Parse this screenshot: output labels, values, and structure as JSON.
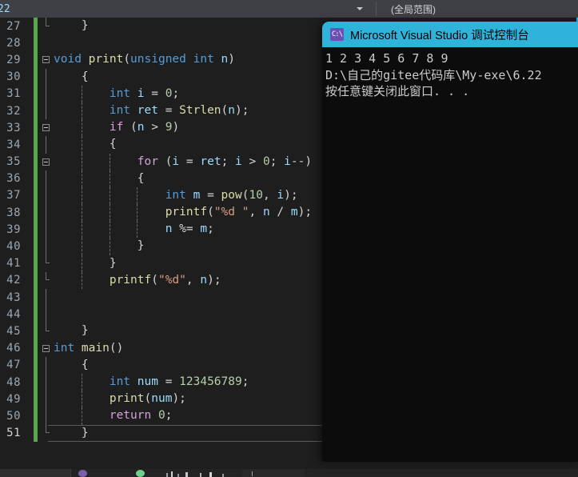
{
  "nav": {
    "member_combo_value": "22",
    "scope_combo_value": "(全局范围)",
    "dropdown_icon": "chevron-down-icon"
  },
  "editor": {
    "language": "C",
    "current_line": 51,
    "lines": [
      {
        "num": "27",
        "indent_guides": [],
        "fold": "endcap",
        "tokens": [
          {
            "t": "    }",
            "c": "pun"
          }
        ]
      },
      {
        "num": "28",
        "indent_guides": [],
        "fold": "",
        "tokens": [
          {
            "t": "",
            "c": "pun"
          }
        ]
      },
      {
        "num": "29",
        "indent_guides": [],
        "fold": "box",
        "tokens": [
          {
            "t": "void ",
            "c": "kw"
          },
          {
            "t": "print",
            "c": "fn"
          },
          {
            "t": "(",
            "c": "pun"
          },
          {
            "t": "unsigned int ",
            "c": "kw"
          },
          {
            "t": "n",
            "c": "var"
          },
          {
            "t": ")",
            "c": "pun"
          }
        ]
      },
      {
        "num": "30",
        "indent_guides": [],
        "fold": "line",
        "tokens": [
          {
            "t": "    {",
            "c": "pun"
          }
        ]
      },
      {
        "num": "31",
        "indent_guides": [
          1
        ],
        "fold": "line",
        "tokens": [
          {
            "t": "        ",
            "c": "pun"
          },
          {
            "t": "int ",
            "c": "kw"
          },
          {
            "t": "i ",
            "c": "var"
          },
          {
            "t": "= ",
            "c": "pun"
          },
          {
            "t": "0",
            "c": "num"
          },
          {
            "t": ";",
            "c": "pun"
          }
        ]
      },
      {
        "num": "32",
        "indent_guides": [
          1
        ],
        "fold": "line",
        "tokens": [
          {
            "t": "        ",
            "c": "pun"
          },
          {
            "t": "int ",
            "c": "kw"
          },
          {
            "t": "ret ",
            "c": "var"
          },
          {
            "t": "= ",
            "c": "pun"
          },
          {
            "t": "Strlen",
            "c": "fn"
          },
          {
            "t": "(",
            "c": "pun"
          },
          {
            "t": "n",
            "c": "var"
          },
          {
            "t": ");",
            "c": "pun"
          }
        ]
      },
      {
        "num": "33",
        "indent_guides": [
          1
        ],
        "fold": "box",
        "tokens": [
          {
            "t": "        ",
            "c": "pun"
          },
          {
            "t": "if ",
            "c": "ctl"
          },
          {
            "t": "(",
            "c": "pun"
          },
          {
            "t": "n ",
            "c": "var"
          },
          {
            "t": "> ",
            "c": "pun"
          },
          {
            "t": "9",
            "c": "num"
          },
          {
            "t": ")",
            "c": "pun"
          }
        ]
      },
      {
        "num": "34",
        "indent_guides": [
          1
        ],
        "fold": "line",
        "tokens": [
          {
            "t": "        {",
            "c": "pun"
          }
        ]
      },
      {
        "num": "35",
        "indent_guides": [
          1,
          2
        ],
        "fold": "box",
        "tokens": [
          {
            "t": "            ",
            "c": "pun"
          },
          {
            "t": "for ",
            "c": "ctl"
          },
          {
            "t": "(",
            "c": "pun"
          },
          {
            "t": "i ",
            "c": "var"
          },
          {
            "t": "= ",
            "c": "pun"
          },
          {
            "t": "ret",
            "c": "var"
          },
          {
            "t": "; ",
            "c": "pun"
          },
          {
            "t": "i ",
            "c": "var"
          },
          {
            "t": "> ",
            "c": "pun"
          },
          {
            "t": "0",
            "c": "num"
          },
          {
            "t": "; ",
            "c": "pun"
          },
          {
            "t": "i",
            "c": "var"
          },
          {
            "t": "--)",
            "c": "pun"
          }
        ]
      },
      {
        "num": "36",
        "indent_guides": [
          1,
          2
        ],
        "fold": "line",
        "tokens": [
          {
            "t": "            {",
            "c": "pun"
          }
        ]
      },
      {
        "num": "37",
        "indent_guides": [
          1,
          2,
          3
        ],
        "fold": "line",
        "tokens": [
          {
            "t": "                ",
            "c": "pun"
          },
          {
            "t": "int ",
            "c": "kw"
          },
          {
            "t": "m ",
            "c": "var"
          },
          {
            "t": "= ",
            "c": "pun"
          },
          {
            "t": "pow",
            "c": "fn"
          },
          {
            "t": "(",
            "c": "pun"
          },
          {
            "t": "10",
            "c": "num"
          },
          {
            "t": ", ",
            "c": "pun"
          },
          {
            "t": "i",
            "c": "var"
          },
          {
            "t": ");",
            "c": "pun"
          }
        ]
      },
      {
        "num": "38",
        "indent_guides": [
          1,
          2,
          3
        ],
        "fold": "line",
        "tokens": [
          {
            "t": "                ",
            "c": "pun"
          },
          {
            "t": "printf",
            "c": "fn"
          },
          {
            "t": "(",
            "c": "pun"
          },
          {
            "t": "\"%d \"",
            "c": "str"
          },
          {
            "t": ", ",
            "c": "pun"
          },
          {
            "t": "n ",
            "c": "var"
          },
          {
            "t": "/ ",
            "c": "pun"
          },
          {
            "t": "m",
            "c": "var"
          },
          {
            "t": ");",
            "c": "pun"
          }
        ]
      },
      {
        "num": "39",
        "indent_guides": [
          1,
          2,
          3
        ],
        "fold": "line",
        "tokens": [
          {
            "t": "                ",
            "c": "pun"
          },
          {
            "t": "n ",
            "c": "var"
          },
          {
            "t": "%= ",
            "c": "pun"
          },
          {
            "t": "m",
            "c": "var"
          },
          {
            "t": ";",
            "c": "pun"
          }
        ]
      },
      {
        "num": "40",
        "indent_guides": [
          1,
          2
        ],
        "fold": "line",
        "tokens": [
          {
            "t": "            }",
            "c": "pun"
          }
        ]
      },
      {
        "num": "41",
        "indent_guides": [
          1
        ],
        "fold": "endcap",
        "tokens": [
          {
            "t": "        }",
            "c": "pun"
          }
        ]
      },
      {
        "num": "42",
        "indent_guides": [
          1
        ],
        "fold": "endcap",
        "tokens": [
          {
            "t": "        ",
            "c": "pun"
          },
          {
            "t": "printf",
            "c": "fn"
          },
          {
            "t": "(",
            "c": "pun"
          },
          {
            "t": "\"%d\"",
            "c": "str"
          },
          {
            "t": ", ",
            "c": "pun"
          },
          {
            "t": "n",
            "c": "var"
          },
          {
            "t": ");",
            "c": "pun"
          }
        ]
      },
      {
        "num": "43",
        "indent_guides": [
          1
        ],
        "fold": "line",
        "tokens": [
          {
            "t": "",
            "c": "pun"
          }
        ]
      },
      {
        "num": "44",
        "indent_guides": [
          1
        ],
        "fold": "line",
        "tokens": [
          {
            "t": "",
            "c": "pun"
          }
        ]
      },
      {
        "num": "45",
        "indent_guides": [],
        "fold": "endcap",
        "tokens": [
          {
            "t": "    }",
            "c": "pun"
          }
        ]
      },
      {
        "num": "46",
        "indent_guides": [],
        "fold": "box",
        "tokens": [
          {
            "t": "int ",
            "c": "kw"
          },
          {
            "t": "main",
            "c": "fn"
          },
          {
            "t": "()",
            "c": "pun"
          }
        ]
      },
      {
        "num": "47",
        "indent_guides": [],
        "fold": "line",
        "tokens": [
          {
            "t": "    {",
            "c": "pun"
          }
        ]
      },
      {
        "num": "48",
        "indent_guides": [
          1
        ],
        "fold": "line",
        "tokens": [
          {
            "t": "        ",
            "c": "pun"
          },
          {
            "t": "int ",
            "c": "kw"
          },
          {
            "t": "num ",
            "c": "var"
          },
          {
            "t": "= ",
            "c": "pun"
          },
          {
            "t": "123456789",
            "c": "num"
          },
          {
            "t": ";",
            "c": "pun"
          }
        ]
      },
      {
        "num": "49",
        "indent_guides": [
          1
        ],
        "fold": "line",
        "tokens": [
          {
            "t": "        ",
            "c": "pun"
          },
          {
            "t": "print",
            "c": "fn"
          },
          {
            "t": "(",
            "c": "pun"
          },
          {
            "t": "num",
            "c": "var"
          },
          {
            "t": ");",
            "c": "pun"
          }
        ]
      },
      {
        "num": "50",
        "indent_guides": [
          1
        ],
        "fold": "line",
        "tokens": [
          {
            "t": "        ",
            "c": "pun"
          },
          {
            "t": "return ",
            "c": "ctl"
          },
          {
            "t": "0",
            "c": "num"
          },
          {
            "t": ";",
            "c": "pun"
          }
        ]
      },
      {
        "num": "51",
        "indent_guides": [],
        "fold": "endcap",
        "tokens": [
          {
            "t": "    }",
            "c": "pun"
          }
        ]
      }
    ]
  },
  "console": {
    "title": "Microsoft Visual Studio 调试控制台",
    "icon": "console-app-icon",
    "icon_glyph": "C:\\",
    "lines": [
      "1 2 3 4 5 6 7 8 9",
      "D:\\自己的gitee代码库\\My-exe\\6.22",
      "按任意键关闭此窗口. . ."
    ]
  },
  "colors": {
    "console_titlebar": "#2fb3da",
    "console_background": "#0c0c0c",
    "editor_background": "#1e1e1e",
    "nav_background": "#3f3f46",
    "change_bar_green": "#57a64a",
    "accent_blue": "#29a8e0"
  }
}
